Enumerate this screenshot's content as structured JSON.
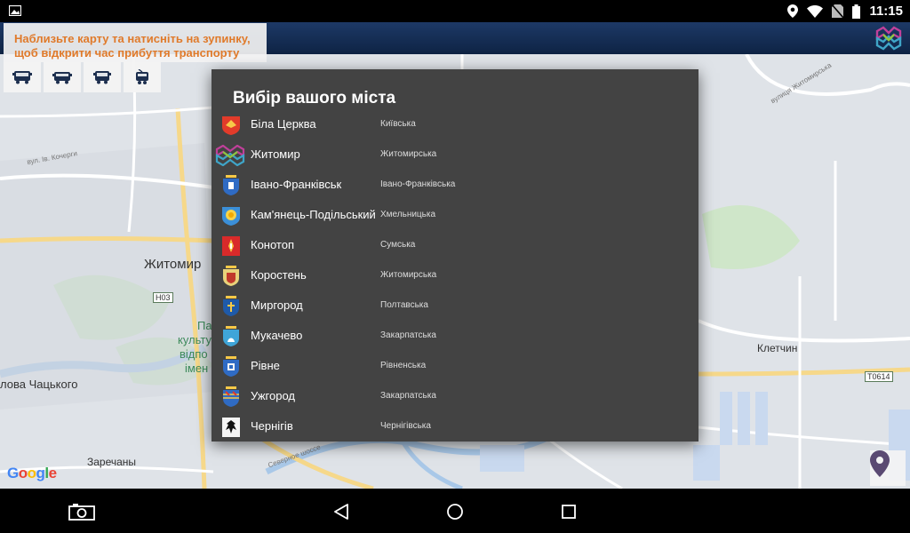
{
  "status_bar": {
    "time": "11:15",
    "icons": [
      "image-icon",
      "location-icon",
      "wifi-icon",
      "no-sim-icon",
      "battery-icon"
    ]
  },
  "hint": {
    "line1": "Наблизьте карту та натисніть на зупинку,",
    "line2": "щоб відкрити час прибуття транспорту"
  },
  "transport_buttons": [
    "bus-icon",
    "trolleybus-icon",
    "minibus-icon",
    "tram-icon"
  ],
  "map": {
    "labels": {
      "zhytomyr": "Житомир",
      "kletchyn": "Клетчин",
      "zarechany": "Заречаны",
      "chatskoho": "лова Чацького",
      "h03": "Н03",
      "t0614": "Т0614",
      "museum1": "Па",
      "museum2": "культу",
      "museum3": "відпо",
      "museum4": "імен",
      "street_korolova": "вул. Ів. Кочерги",
      "street_zhytomyrska": "вулиця Житомирська",
      "street_severna": "Северное шоссе"
    }
  },
  "google": {
    "g": "G",
    "o1": "o",
    "o2": "o",
    "g2": "g",
    "l": "l",
    "e": "e"
  },
  "dialog": {
    "title": "Вибір вашого міста",
    "cities": [
      {
        "name": "Біла Церква",
        "region": "Київська",
        "crest": "bila-tserkva-crest-icon"
      },
      {
        "name": "Житомир",
        "region": "Житомирська",
        "crest": "zhytomyr-logo-icon"
      },
      {
        "name": "Івано-Франківськ",
        "region": "Івано-Франківська",
        "crest": "ivano-frankivsk-crest-icon"
      },
      {
        "name": "Кам'янець-Подільський",
        "region": "Хмельницька",
        "crest": "kamianets-crest-icon"
      },
      {
        "name": "Конотоп",
        "region": "Сумська",
        "crest": "konotop-crest-icon"
      },
      {
        "name": "Коростень",
        "region": "Житомирська",
        "crest": "korosten-crest-icon"
      },
      {
        "name": "Миргород",
        "region": "Полтавська",
        "crest": "myrhorod-crest-icon"
      },
      {
        "name": "Мукачево",
        "region": "Закарпатська",
        "crest": "mukachevo-crest-icon"
      },
      {
        "name": "Рівне",
        "region": "Рівненська",
        "crest": "rivne-crest-icon"
      },
      {
        "name": "Ужгород",
        "region": "Закарпатська",
        "crest": "uzhhorod-crest-icon"
      },
      {
        "name": "Чернігів",
        "region": "Чернігівська",
        "crest": "chernihiv-crest-icon"
      }
    ]
  },
  "colors": {
    "accent_orange": "#e07a2a",
    "app_bar": "#1d3966",
    "dialog_bg": "#434343",
    "location_pin": "#5b4a72"
  },
  "nav_bar": [
    "camera-icon",
    "back-icon",
    "home-icon",
    "recents-icon"
  ]
}
